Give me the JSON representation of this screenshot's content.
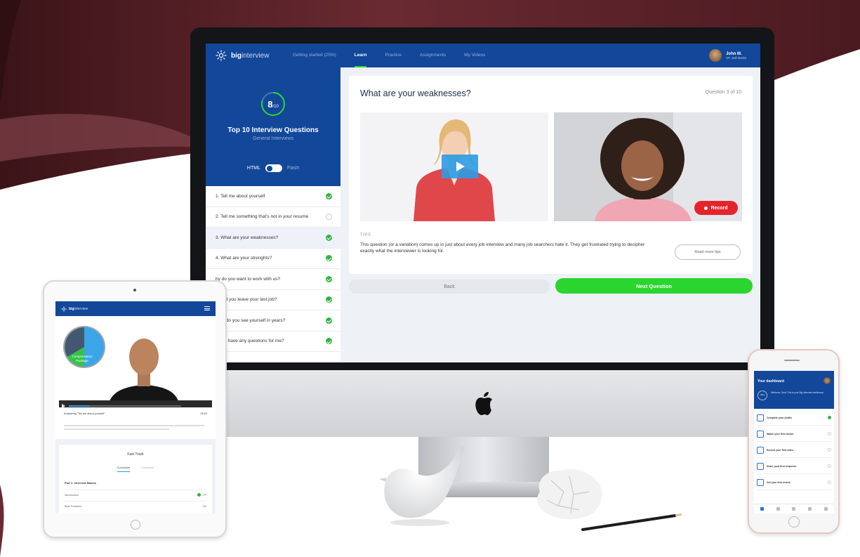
{
  "colors": {
    "brand_blue": "#12479a",
    "accent_green": "#2bd52f",
    "record_red": "#e5232b",
    "background_wave": "#5a1f26"
  },
  "imac": {
    "brand": {
      "bold": "big",
      "light": "interview"
    },
    "nav": {
      "items": [
        {
          "label": "Getting started (25%)",
          "active": false
        },
        {
          "label": "Learn",
          "active": true
        },
        {
          "label": "Practice",
          "active": false
        },
        {
          "label": "Assignments",
          "active": false
        },
        {
          "label": "My Videos",
          "active": false
        }
      ]
    },
    "user": {
      "name": "John M.",
      "subtitle": "VP, Sell Media"
    },
    "sidebar": {
      "score": "8",
      "score_total": "/10",
      "title": "Top 10 Interview Questions",
      "subtitle": "General Interviews",
      "toggle_left": "HTML",
      "toggle_right": "Flash",
      "questions": [
        {
          "text": "1. Tell me about yourself",
          "done": true
        },
        {
          "text": "2. Tell me something that's not in your resume",
          "done": false
        },
        {
          "text": "3. What are your weaknesses?",
          "done": true
        },
        {
          "text": "4. What are your strenghts?",
          "done": true
        },
        {
          "text": "hy do you want to work with us?",
          "done": true
        },
        {
          "text": "hy did you leave your last job?",
          "done": true
        },
        {
          "text": "here do you see yourself in years?",
          "done": true
        },
        {
          "text": "o you have any questions for me?",
          "done": true
        }
      ]
    },
    "main": {
      "question_title": "What are your weaknesses?",
      "question_count": "Question 3 of 10",
      "record_label": "Record",
      "tips_label": "TIPS",
      "tips_text": "This question (or a variation) comes up in just about every job interview and many job searchers hate it. They get frustrated trying to decipher exactly what the interviewer is looking for.",
      "read_more_label": "Read more tips",
      "back_label": "Back",
      "next_label": "Next Question"
    }
  },
  "ipad": {
    "brand": {
      "bold": "big",
      "light": "interview"
    },
    "chart_label": "Compensation Package",
    "caption": "Answering \"Tell me about yourself\"",
    "time": "05:20",
    "fast_track_title": "Fast Track",
    "tabs": [
      {
        "label": "Curriculum",
        "active": true
      },
      {
        "label": "Comments",
        "active": false
      }
    ],
    "part_title": "Part 1: Interview Basics",
    "rows": [
      {
        "label": "Introduction",
        "value": "1/4",
        "done": true
      },
      {
        "label": "Best Practices",
        "value": "0/3",
        "done": false
      }
    ]
  },
  "iphone": {
    "title": "Your dashboard",
    "ring": "33%",
    "welcome": "Welcome, Sam! This is your Big Interview dashboard.",
    "items": [
      {
        "label": "Complete your profile",
        "done": true
      },
      {
        "label": "Watch your first lesson",
        "done": false
      },
      {
        "label": "Record your first video",
        "done": false
      },
      {
        "label": "Share your first response",
        "done": false
      },
      {
        "label": "Get your first review",
        "done": false
      }
    ]
  }
}
